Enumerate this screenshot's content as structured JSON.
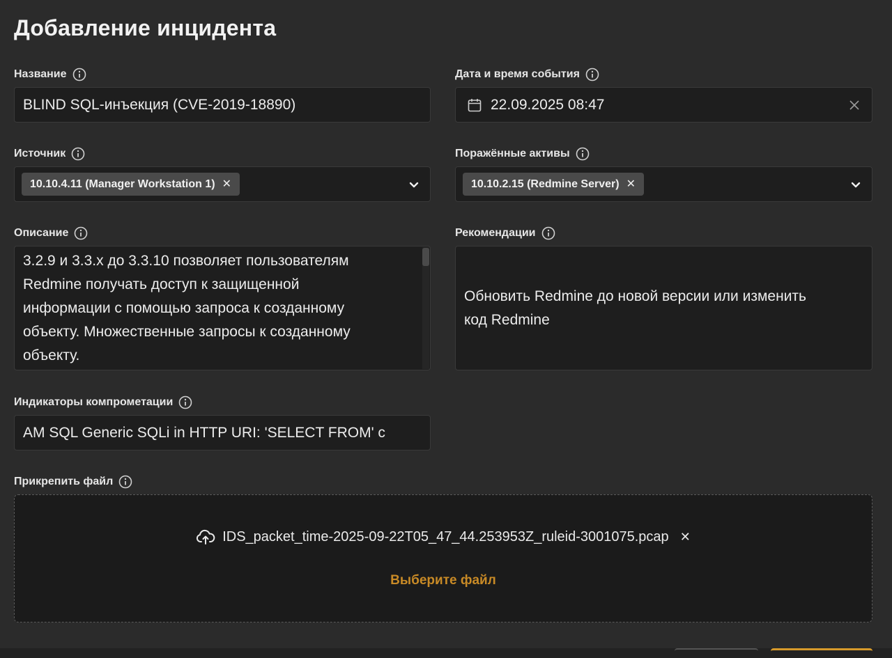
{
  "page": {
    "title": "Добавление инцидента"
  },
  "fields": {
    "name": {
      "label": "Название",
      "value": "BLIND SQL-инъекция (CVE-2019-18890)"
    },
    "event_datetime": {
      "label": "Дата и время события",
      "value": "22.09.2025 08:47"
    },
    "source": {
      "label": "Источник",
      "chips": [
        "10.10.4.11 (Manager Workstation 1)"
      ]
    },
    "affected_assets": {
      "label": "Поражённые активы",
      "chips": [
        "10.10.2.15 (Redmine Server)"
      ]
    },
    "description": {
      "label": "Описание",
      "lines": [
        "3.2.9 и 3.3.x до 3.3.10 позволяет пользователям",
        "Redmine получать доступ к защищенной",
        "информации с помощью запроса к созданному",
        "объекту. Множественные запросы к созданному",
        "объекту."
      ]
    },
    "recommendations": {
      "label": "Рекомендации",
      "lines": [
        "Обновить Redmine до новой версии или изменить",
        "код Redmine"
      ]
    },
    "ioc": {
      "label": "Индикаторы компрометации",
      "value": "AM SQL Generic SQLi in HTTP URI: 'SELECT FROM' c"
    },
    "attachment": {
      "label": "Прикрепить файл",
      "file_name": "IDS_packet_time-2025-09-22T05_47_44.253953Z_ruleid-3001075.pcap",
      "choose_label": "Выберите файл"
    }
  },
  "icons": {
    "info": "info-icon",
    "calendar": "calendar-icon",
    "clear": "close-icon",
    "chevron": "chevron-down-icon",
    "upload": "upload-cloud-icon",
    "remove": "remove-icon"
  },
  "colors": {
    "background": "#2b2b2b",
    "field_bg": "#1e1e1e",
    "chip_bg": "#4a4a4a",
    "accent": "#c88a26"
  }
}
